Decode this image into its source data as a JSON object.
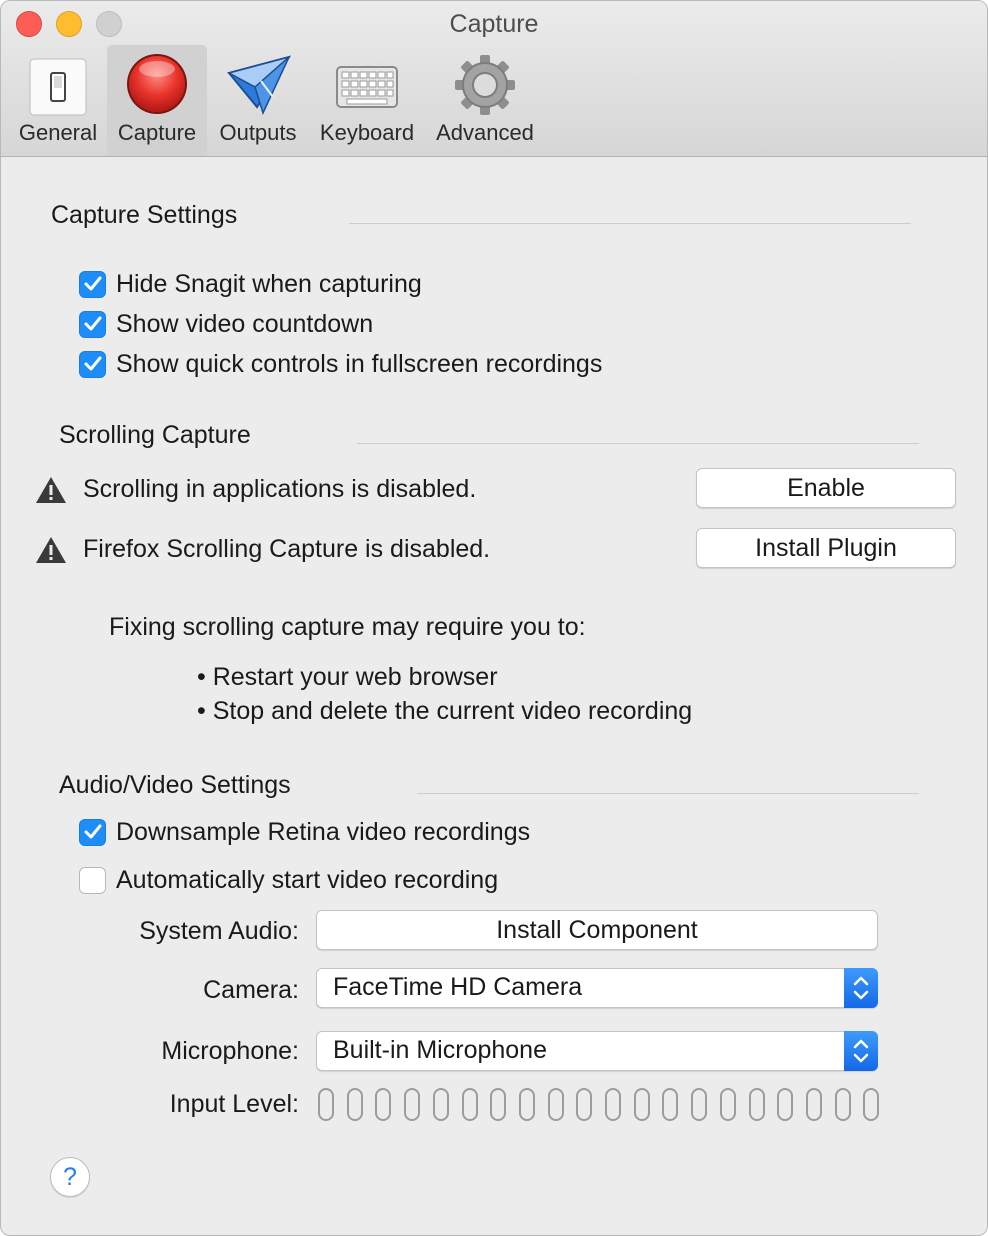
{
  "window": {
    "title": "Capture"
  },
  "toolbar": {
    "items": [
      {
        "label": "General",
        "icon": "switch-icon"
      },
      {
        "label": "Capture",
        "icon": "record-icon",
        "selected": true
      },
      {
        "label": "Outputs",
        "icon": "paper-plane-icon"
      },
      {
        "label": "Keyboard",
        "icon": "keyboard-icon"
      },
      {
        "label": "Advanced",
        "icon": "gear-icon"
      }
    ]
  },
  "capture_settings": {
    "title": "Capture Settings",
    "options": [
      {
        "label": "Hide Snagit when capturing",
        "checked": true
      },
      {
        "label": "Show video countdown",
        "checked": true
      },
      {
        "label": "Show quick controls in fullscreen recordings",
        "checked": true
      }
    ]
  },
  "scrolling_capture": {
    "title": "Scrolling Capture",
    "warnings": [
      {
        "text": "Scrolling in applications is disabled.",
        "button": "Enable"
      },
      {
        "text": "Firefox Scrolling Capture is disabled.",
        "button": "Install Plugin"
      }
    ],
    "note": "Fixing scrolling capture may require you to:",
    "bullets": [
      "• Restart your web browser",
      "• Stop and delete the current video recording"
    ]
  },
  "av_settings": {
    "title": "Audio/Video Settings",
    "options": [
      {
        "label": "Downsample Retina video recordings",
        "checked": true
      },
      {
        "label": "Automatically start video recording",
        "checked": false
      }
    ],
    "system_audio": {
      "label": "System Audio:",
      "button": "Install Component"
    },
    "camera": {
      "label": "Camera:",
      "value": "FaceTime HD Camera"
    },
    "microphone": {
      "label": "Microphone:",
      "value": "Built-in Microphone"
    },
    "input_level": {
      "label": "Input Level:",
      "segments": 20,
      "level": 0
    }
  },
  "help": {
    "glyph": "?"
  },
  "colors": {
    "accent": "#1d8df8",
    "warning": "#3a3a3a"
  }
}
